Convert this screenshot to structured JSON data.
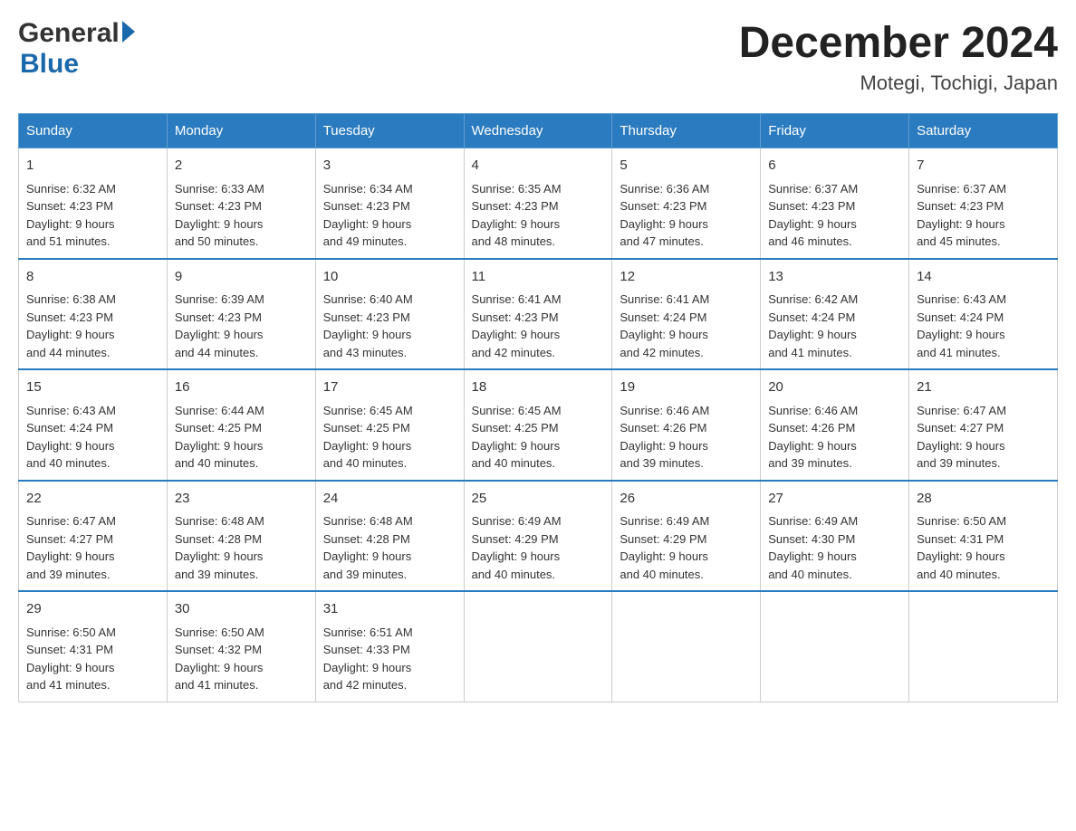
{
  "logo": {
    "general": "General",
    "blue": "Blue"
  },
  "header": {
    "title": "December 2024",
    "subtitle": "Motegi, Tochigi, Japan"
  },
  "weekdays": [
    "Sunday",
    "Monday",
    "Tuesday",
    "Wednesday",
    "Thursday",
    "Friday",
    "Saturday"
  ],
  "weeks": [
    [
      {
        "day": "1",
        "sunrise": "6:32 AM",
        "sunset": "4:23 PM",
        "daylight": "9 hours and 51 minutes."
      },
      {
        "day": "2",
        "sunrise": "6:33 AM",
        "sunset": "4:23 PM",
        "daylight": "9 hours and 50 minutes."
      },
      {
        "day": "3",
        "sunrise": "6:34 AM",
        "sunset": "4:23 PM",
        "daylight": "9 hours and 49 minutes."
      },
      {
        "day": "4",
        "sunrise": "6:35 AM",
        "sunset": "4:23 PM",
        "daylight": "9 hours and 48 minutes."
      },
      {
        "day": "5",
        "sunrise": "6:36 AM",
        "sunset": "4:23 PM",
        "daylight": "9 hours and 47 minutes."
      },
      {
        "day": "6",
        "sunrise": "6:37 AM",
        "sunset": "4:23 PM",
        "daylight": "9 hours and 46 minutes."
      },
      {
        "day": "7",
        "sunrise": "6:37 AM",
        "sunset": "4:23 PM",
        "daylight": "9 hours and 45 minutes."
      }
    ],
    [
      {
        "day": "8",
        "sunrise": "6:38 AM",
        "sunset": "4:23 PM",
        "daylight": "9 hours and 44 minutes."
      },
      {
        "day": "9",
        "sunrise": "6:39 AM",
        "sunset": "4:23 PM",
        "daylight": "9 hours and 44 minutes."
      },
      {
        "day": "10",
        "sunrise": "6:40 AM",
        "sunset": "4:23 PM",
        "daylight": "9 hours and 43 minutes."
      },
      {
        "day": "11",
        "sunrise": "6:41 AM",
        "sunset": "4:23 PM",
        "daylight": "9 hours and 42 minutes."
      },
      {
        "day": "12",
        "sunrise": "6:41 AM",
        "sunset": "4:24 PM",
        "daylight": "9 hours and 42 minutes."
      },
      {
        "day": "13",
        "sunrise": "6:42 AM",
        "sunset": "4:24 PM",
        "daylight": "9 hours and 41 minutes."
      },
      {
        "day": "14",
        "sunrise": "6:43 AM",
        "sunset": "4:24 PM",
        "daylight": "9 hours and 41 minutes."
      }
    ],
    [
      {
        "day": "15",
        "sunrise": "6:43 AM",
        "sunset": "4:24 PM",
        "daylight": "9 hours and 40 minutes."
      },
      {
        "day": "16",
        "sunrise": "6:44 AM",
        "sunset": "4:25 PM",
        "daylight": "9 hours and 40 minutes."
      },
      {
        "day": "17",
        "sunrise": "6:45 AM",
        "sunset": "4:25 PM",
        "daylight": "9 hours and 40 minutes."
      },
      {
        "day": "18",
        "sunrise": "6:45 AM",
        "sunset": "4:25 PM",
        "daylight": "9 hours and 40 minutes."
      },
      {
        "day": "19",
        "sunrise": "6:46 AM",
        "sunset": "4:26 PM",
        "daylight": "9 hours and 39 minutes."
      },
      {
        "day": "20",
        "sunrise": "6:46 AM",
        "sunset": "4:26 PM",
        "daylight": "9 hours and 39 minutes."
      },
      {
        "day": "21",
        "sunrise": "6:47 AM",
        "sunset": "4:27 PM",
        "daylight": "9 hours and 39 minutes."
      }
    ],
    [
      {
        "day": "22",
        "sunrise": "6:47 AM",
        "sunset": "4:27 PM",
        "daylight": "9 hours and 39 minutes."
      },
      {
        "day": "23",
        "sunrise": "6:48 AM",
        "sunset": "4:28 PM",
        "daylight": "9 hours and 39 minutes."
      },
      {
        "day": "24",
        "sunrise": "6:48 AM",
        "sunset": "4:28 PM",
        "daylight": "9 hours and 39 minutes."
      },
      {
        "day": "25",
        "sunrise": "6:49 AM",
        "sunset": "4:29 PM",
        "daylight": "9 hours and 40 minutes."
      },
      {
        "day": "26",
        "sunrise": "6:49 AM",
        "sunset": "4:29 PM",
        "daylight": "9 hours and 40 minutes."
      },
      {
        "day": "27",
        "sunrise": "6:49 AM",
        "sunset": "4:30 PM",
        "daylight": "9 hours and 40 minutes."
      },
      {
        "day": "28",
        "sunrise": "6:50 AM",
        "sunset": "4:31 PM",
        "daylight": "9 hours and 40 minutes."
      }
    ],
    [
      {
        "day": "29",
        "sunrise": "6:50 AM",
        "sunset": "4:31 PM",
        "daylight": "9 hours and 41 minutes."
      },
      {
        "day": "30",
        "sunrise": "6:50 AM",
        "sunset": "4:32 PM",
        "daylight": "9 hours and 41 minutes."
      },
      {
        "day": "31",
        "sunrise": "6:51 AM",
        "sunset": "4:33 PM",
        "daylight": "9 hours and 42 minutes."
      },
      null,
      null,
      null,
      null
    ]
  ],
  "labels": {
    "sunrise": "Sunrise:",
    "sunset": "Sunset:",
    "daylight": "Daylight:"
  }
}
